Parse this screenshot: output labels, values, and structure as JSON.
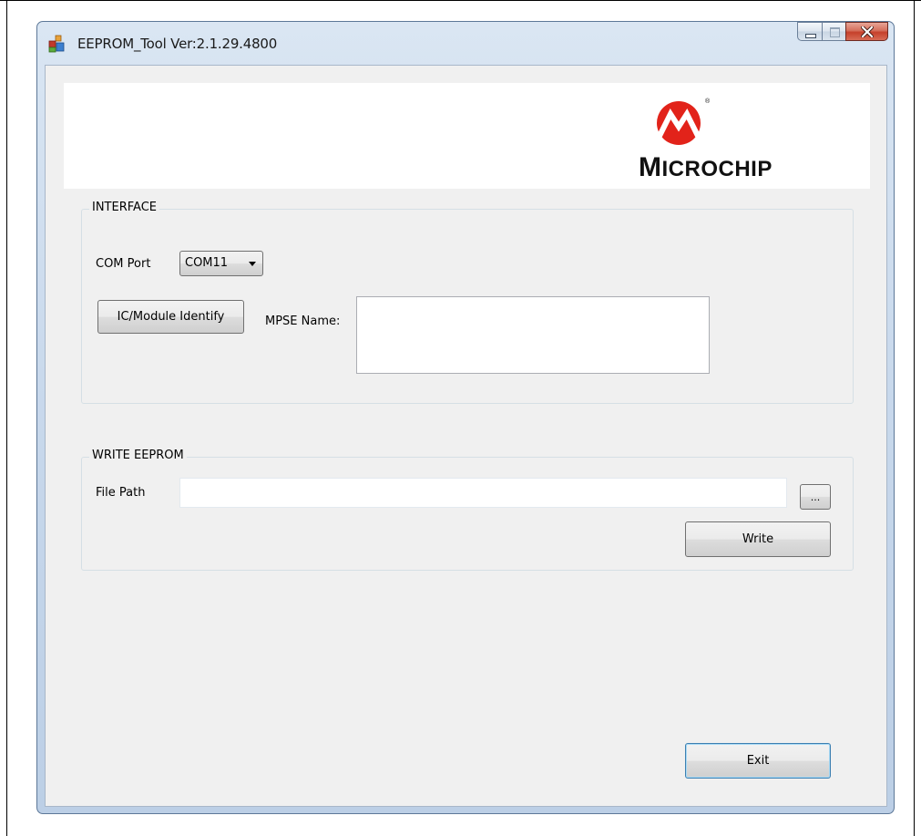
{
  "window": {
    "title": "EEPROM_Tool Ver:2.1.29.4800",
    "icons": {
      "app": "app-icon",
      "minimize": "minimize-icon",
      "maximize": "maximize-icon",
      "close": "close-icon"
    }
  },
  "banner": {
    "logo_text": {
      "first": "M",
      "rest": "ICROCHIP"
    },
    "logo_icon": "microchip-logo-icon",
    "brand_color": "#e2231a"
  },
  "interface": {
    "group_title": "INTERFACE",
    "com_port_label": "COM Port",
    "com_port_value": "COM11",
    "identify_button": "IC/Module Identify",
    "mpse_label": "MPSE Name:",
    "mpse_value": ""
  },
  "write_eeprom": {
    "group_title": "WRITE EEPROM",
    "file_path_label": "File Path",
    "file_path_value": "",
    "browse_button": "...",
    "write_button": "Write"
  },
  "footer": {
    "exit_button": "Exit"
  }
}
